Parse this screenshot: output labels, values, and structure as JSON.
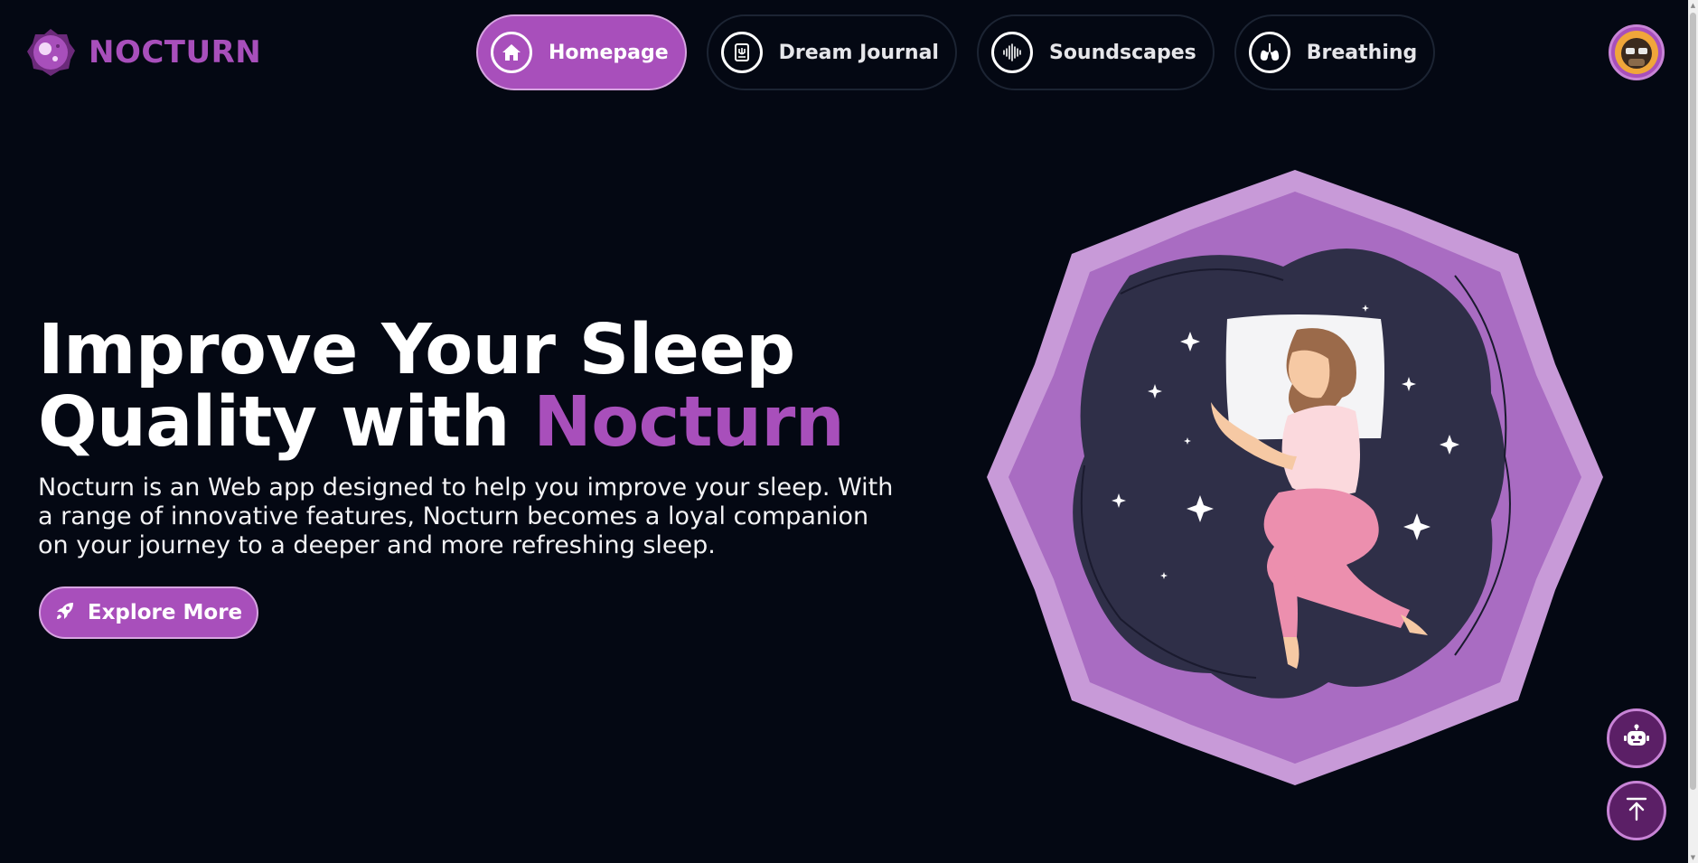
{
  "brand": {
    "name": "NOCTURN",
    "accent_color": "#a84fbb",
    "background_color": "#040813"
  },
  "nav": {
    "items": [
      {
        "label": "Homepage",
        "icon": "home-icon",
        "active": true
      },
      {
        "label": "Dream Journal",
        "icon": "journal-icon",
        "active": false
      },
      {
        "label": "Soundscapes",
        "icon": "soundwave-icon",
        "active": false
      },
      {
        "label": "Breathing",
        "icon": "lungs-icon",
        "active": false
      }
    ]
  },
  "user": {
    "avatar_icon": "avatar-icon"
  },
  "hero": {
    "title_line1": "Improve Your Sleep",
    "title_line2_prefix": "Quality with ",
    "title_line2_accent": "Nocturn",
    "description": "Nocturn is an Web app designed to help you improve your sleep. With a range of innovative features, Nocturn becomes a loyal companion on your journey to a deeper and more refreshing sleep.",
    "cta_label": "Explore More",
    "cta_icon": "rocket-icon",
    "illustration": "sleeping-woman-illustration"
  },
  "floating": {
    "chatbot_icon": "robot-icon",
    "scroll_top_icon": "arrow-up-to-top-icon"
  }
}
